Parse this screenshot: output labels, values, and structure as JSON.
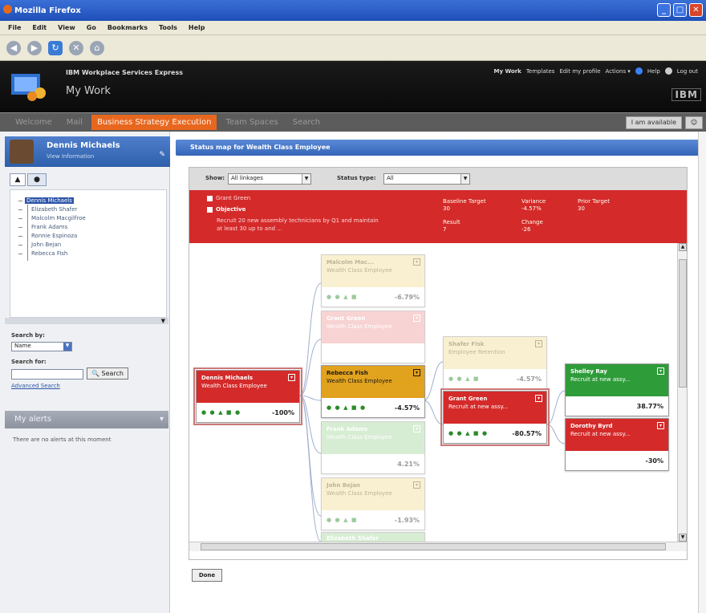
{
  "window": {
    "title": "Mozilla Firefox"
  },
  "menu": [
    "File",
    "Edit",
    "View",
    "Go",
    "Bookmarks",
    "Tools",
    "Help"
  ],
  "header": {
    "product": "IBM Workplace Services Express",
    "app_title": "My Work",
    "top_links": [
      "My Work",
      "Templates",
      "Edit my profile",
      "Actions ▾",
      "Help",
      "Log out"
    ],
    "brand": "IBM"
  },
  "tabs": [
    "Welcome",
    "Mail",
    "Business Strategy Execution",
    "Team Spaces",
    "Search"
  ],
  "availability": "I am available",
  "user": {
    "name": "Dennis Michaels",
    "link": "View Information"
  },
  "tree": {
    "root": "Dennis Michaels",
    "children": [
      "Elizabeth Shafer",
      "Malcolm Macgilfroe",
      "Frank Adams",
      "Ronnie Espinoza",
      "John Bejan",
      "Rebecca Fish"
    ]
  },
  "search": {
    "by_label": "Search by:",
    "by_value": "Name",
    "for_label": "Search for:",
    "button": "Search",
    "advanced": "Advanced Search"
  },
  "alerts": {
    "title": "My alerts",
    "message": "There are no alerts at this moment"
  },
  "main": {
    "heading": "Status map for Wealth Class Employee",
    "filters": {
      "show_label": "Show:",
      "show_value": "All linkages",
      "status_label": "Status type:",
      "status_value": "All"
    },
    "objective": {
      "owner": "Grant Green",
      "label": "Objective",
      "text_line1": "Recruit 20 new assembly technicians by Q1 and maintain",
      "text_line2": "at least 30 up to and ...",
      "metrics": [
        {
          "label": "Baseline Target",
          "value": "30"
        },
        {
          "label": "Variance",
          "value": "-4.57%"
        },
        {
          "label": "Prior Target",
          "value": "30"
        },
        {
          "label": "Result",
          "value": "7"
        },
        {
          "label": "Change",
          "value": "-26"
        }
      ]
    },
    "done_button": "Done"
  },
  "nodes": [
    {
      "id": "root",
      "name": "Dennis Michaels",
      "role": "Wealth Class Employee",
      "value": "-100%",
      "color": "#d42a2a"
    },
    {
      "id": "n1",
      "name": "Malcolm Mac...",
      "role": "Wealth Class Employee",
      "value": "-6.79%",
      "color": "#f3df9a"
    },
    {
      "id": "n2",
      "name": "Grant Green",
      "role": "Wealth Class Employee",
      "value": "",
      "color": "#f0a0a0"
    },
    {
      "id": "n3",
      "name": "Rebecca Fish",
      "role": "Wealth Class Employee",
      "value": "-4.57%",
      "color": "#e1a21e"
    },
    {
      "id": "n4",
      "name": "Frank Adams",
      "role": "Wealth Class Employee",
      "value": "4.21%",
      "color": "#a8d8a0"
    },
    {
      "id": "n5",
      "name": "John Bejan",
      "role": "Wealth Class Employee",
      "value": "-1.93%",
      "color": "#f3df9a"
    },
    {
      "id": "n6",
      "name": "Elizabeth Shafer",
      "role": "",
      "value": "",
      "color": "#a8d8a0"
    },
    {
      "id": "n7",
      "name": "Shafer Fisk",
      "role": "Employee Retention",
      "value": "-4.57%",
      "color": "#f3df9a"
    },
    {
      "id": "n8",
      "name": "Grant Green",
      "role": "Recruit at new assy...",
      "value": "-80.57%",
      "color": "#d42a2a"
    },
    {
      "id": "n9",
      "name": "Shelley Ray",
      "role": "Recruit at new assy...",
      "value": "38.77%",
      "color": "#2f9c3a"
    },
    {
      "id": "n10",
      "name": "Dorothy Byrd",
      "role": "Recruit at new assy...",
      "value": "-30%",
      "color": "#d42a2a"
    }
  ],
  "icons": {
    "back": "back-arrow-icon",
    "forward": "forward-arrow-icon",
    "reload": "reload-icon",
    "stop": "stop-icon",
    "home": "home-icon"
  }
}
